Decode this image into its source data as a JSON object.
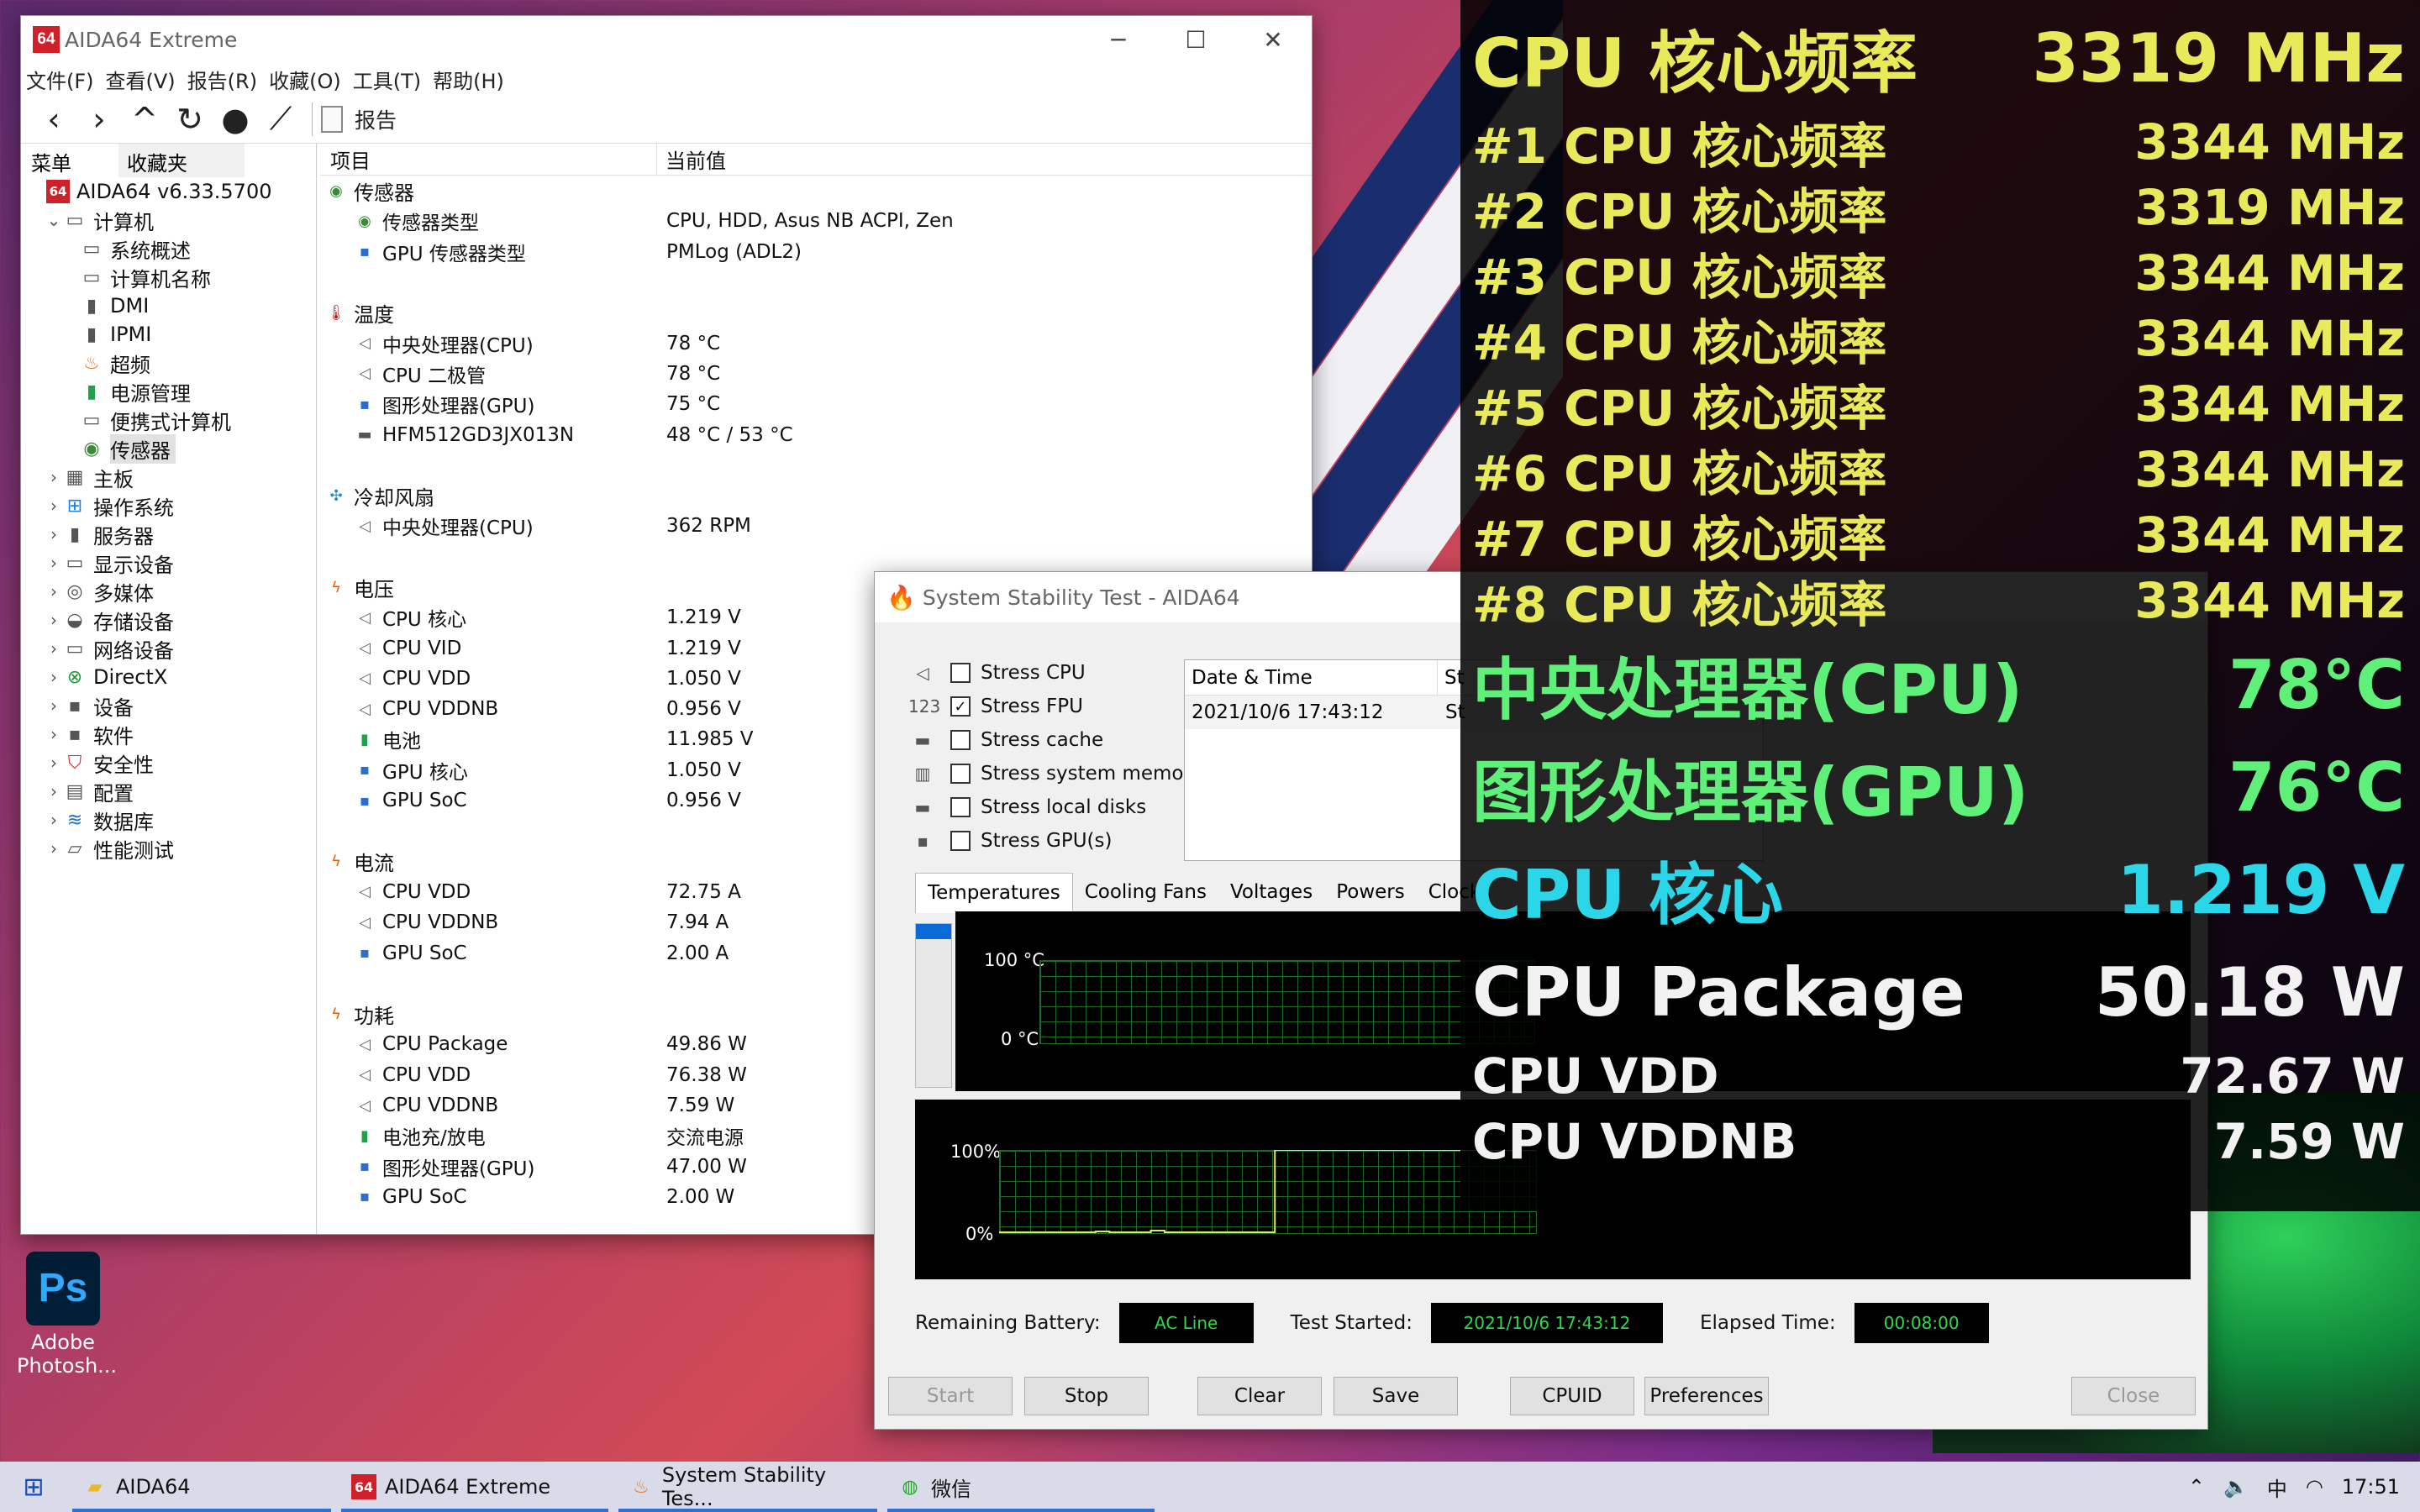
{
  "main_window": {
    "title": "AIDA64 Extreme",
    "menu": [
      "文件(F)",
      "查看(V)",
      "报告(R)",
      "收藏(O)",
      "工具(T)",
      "帮助(H)"
    ],
    "toolbar_report": "报告",
    "left_tabs": [
      "菜单",
      "收藏夹"
    ],
    "tree": [
      {
        "label": "AIDA64 v6.33.5700",
        "icon": "aida64-icon",
        "level": 0,
        "expander": ""
      },
      {
        "label": "计算机",
        "icon": "computer-icon",
        "level": 1,
        "expander": "v"
      },
      {
        "label": "系统概述",
        "icon": "computer-icon",
        "level": 2,
        "expander": ""
      },
      {
        "label": "计算机名称",
        "icon": "computer-icon",
        "level": 2,
        "expander": ""
      },
      {
        "label": "DMI",
        "icon": "dmi-icon",
        "level": 2,
        "expander": ""
      },
      {
        "label": "IPMI",
        "icon": "ipmi-icon",
        "level": 2,
        "expander": ""
      },
      {
        "label": "超频",
        "icon": "flame-icon",
        "level": 2,
        "expander": ""
      },
      {
        "label": "电源管理",
        "icon": "battery-icon",
        "level": 2,
        "expander": ""
      },
      {
        "label": "便携式计算机",
        "icon": "laptop-icon",
        "level": 2,
        "expander": ""
      },
      {
        "label": "传感器",
        "icon": "sensor-icon",
        "level": 2,
        "expander": "",
        "selected": true
      },
      {
        "label": "主板",
        "icon": "motherboard-icon",
        "level": 1,
        "expander": ">"
      },
      {
        "label": "操作系统",
        "icon": "windows-icon",
        "level": 1,
        "expander": ">"
      },
      {
        "label": "服务器",
        "icon": "server-icon",
        "level": 1,
        "expander": ">"
      },
      {
        "label": "显示设备",
        "icon": "monitor-icon",
        "level": 1,
        "expander": ">"
      },
      {
        "label": "多媒体",
        "icon": "multimedia-icon",
        "level": 1,
        "expander": ">"
      },
      {
        "label": "存储设备",
        "icon": "storage-icon",
        "level": 1,
        "expander": ">"
      },
      {
        "label": "网络设备",
        "icon": "network-icon",
        "level": 1,
        "expander": ">"
      },
      {
        "label": "DirectX",
        "icon": "xbox-icon",
        "level": 1,
        "expander": ">"
      },
      {
        "label": "设备",
        "icon": "device-icon",
        "level": 1,
        "expander": ">"
      },
      {
        "label": "软件",
        "icon": "software-icon",
        "level": 1,
        "expander": ">"
      },
      {
        "label": "安全性",
        "icon": "shield-icon",
        "level": 1,
        "expander": ">"
      },
      {
        "label": "配置",
        "icon": "config-icon",
        "level": 1,
        "expander": ">"
      },
      {
        "label": "数据库",
        "icon": "database-icon",
        "level": 1,
        "expander": ">"
      },
      {
        "label": "性能测试",
        "icon": "benchmark-icon",
        "level": 1,
        "expander": ">"
      }
    ],
    "columns": [
      "项目",
      "当前值"
    ],
    "groups": [
      {
        "name": "传感器",
        "icon": "sensor-icon",
        "items": [
          {
            "k": "传感器类型",
            "v": "CPU, HDD, Asus NB ACPI, Zen",
            "icon": "sensor-icon"
          },
          {
            "k": "GPU 传感器类型",
            "v": "PMLog  (ADL2)",
            "icon": "gpu-icon"
          }
        ]
      },
      {
        "name": "温度",
        "icon": "thermometer-icon",
        "items": [
          {
            "k": "中央处理器(CPU)",
            "v": "78 °C",
            "icon": "cpu-icon"
          },
          {
            "k": "CPU 二极管",
            "v": "78 °C",
            "icon": "cpu-icon"
          },
          {
            "k": "图形处理器(GPU)",
            "v": "75 °C",
            "icon": "gpu-icon"
          },
          {
            "k": "HFM512GD3JX013N",
            "v": "48 °C / 53 °C",
            "icon": "disk-icon"
          }
        ]
      },
      {
        "name": "冷却风扇",
        "icon": "fan-icon",
        "items": [
          {
            "k": "中央处理器(CPU)",
            "v": "362 RPM",
            "icon": "cpu-icon"
          }
        ]
      },
      {
        "name": "电压",
        "icon": "voltage-icon",
        "items": [
          {
            "k": "CPU 核心",
            "v": "1.219 V",
            "icon": "cpu-icon"
          },
          {
            "k": "CPU VID",
            "v": "1.219 V",
            "icon": "cpu-icon"
          },
          {
            "k": "CPU VDD",
            "v": "1.050 V",
            "icon": "cpu-icon"
          },
          {
            "k": "CPU VDDNB",
            "v": "0.956 V",
            "icon": "cpu-icon"
          },
          {
            "k": "电池",
            "v": "11.985 V",
            "icon": "battery-icon"
          },
          {
            "k": "GPU 核心",
            "v": "1.050 V",
            "icon": "gpu-icon"
          },
          {
            "k": "GPU SoC",
            "v": "0.956 V",
            "icon": "gpu-icon"
          }
        ]
      },
      {
        "name": "电流",
        "icon": "current-icon",
        "items": [
          {
            "k": "CPU VDD",
            "v": "72.75 A",
            "icon": "cpu-icon"
          },
          {
            "k": "CPU VDDNB",
            "v": "7.94 A",
            "icon": "cpu-icon"
          },
          {
            "k": "GPU SoC",
            "v": "2.00 A",
            "icon": "gpu-icon"
          }
        ]
      },
      {
        "name": "功耗",
        "icon": "power-icon",
        "items": [
          {
            "k": "CPU Package",
            "v": "49.86 W",
            "icon": "cpu-icon"
          },
          {
            "k": "CPU VDD",
            "v": "76.38 W",
            "icon": "cpu-icon"
          },
          {
            "k": "CPU VDDNB",
            "v": "7.59 W",
            "icon": "cpu-icon"
          },
          {
            "k": "电池充/放电",
            "v": "交流电源",
            "icon": "battery-icon"
          },
          {
            "k": "图形处理器(GPU)",
            "v": "47.00 W",
            "icon": "gpu-icon"
          },
          {
            "k": "GPU SoC",
            "v": "2.00 W",
            "icon": "gpu-icon"
          }
        ]
      }
    ]
  },
  "stability": {
    "title": "System Stability Test - AIDA64",
    "stress": [
      {
        "label": "Stress CPU",
        "checked": false,
        "icon": "cpu-chip-icon"
      },
      {
        "label": "Stress FPU",
        "checked": true,
        "icon": "fpu-icon"
      },
      {
        "label": "Stress cache",
        "checked": false,
        "icon": "cache-icon"
      },
      {
        "label": "Stress system memory",
        "checked": false,
        "icon": "memory-icon"
      },
      {
        "label": "Stress local disks",
        "checked": false,
        "icon": "disk-icon"
      },
      {
        "label": "Stress GPU(s)",
        "checked": false,
        "icon": "gpu-icon"
      }
    ],
    "log_headers": [
      "Date & Time",
      "St"
    ],
    "log_rows": [
      {
        "time": "2021/10/6 17:43:12",
        "status": "St"
      }
    ],
    "tabs": [
      "Temperatures",
      "Cooling Fans",
      "Voltages",
      "Powers",
      "Clocks"
    ],
    "graph1_labels": [
      "100 °C",
      "0 °C"
    ],
    "graph2_labels": [
      "100%",
      "0%"
    ],
    "graph2_series": {
      "cpu_usage_percent": [
        2,
        2,
        2,
        2,
        2,
        2,
        2,
        3,
        2,
        2,
        2,
        4,
        2,
        2,
        2,
        2,
        2,
        2,
        2,
        2,
        100,
        100,
        100,
        100,
        100,
        100,
        100,
        100,
        100,
        100,
        100,
        100,
        100,
        100,
        100,
        100,
        100,
        100,
        100,
        100
      ]
    },
    "status": {
      "battery_label": "Remaining Battery:",
      "battery": "AC Line",
      "started_label": "Test Started:",
      "started": "2021/10/6 17:43:12",
      "elapsed_label": "Elapsed Time:",
      "elapsed": "00:08:00"
    },
    "buttons": {
      "start": "Start",
      "stop": "Stop",
      "clear": "Clear",
      "save": "Save",
      "cpuid": "CPUID",
      "preferences": "Preferences",
      "close": "Close"
    }
  },
  "osd": [
    {
      "label": "CPU 核心频率",
      "value": "3319 MHz",
      "color": "#e8ea5a",
      "size": "big"
    },
    {
      "label": "#1 CPU 核心频率",
      "value": "3344 MHz",
      "color": "#e8ea5a",
      "size": "med"
    },
    {
      "label": "#2 CPU 核心频率",
      "value": "3319 MHz",
      "color": "#e8ea5a",
      "size": "med"
    },
    {
      "label": "#3 CPU 核心频率",
      "value": "3344 MHz",
      "color": "#e8ea5a",
      "size": "med"
    },
    {
      "label": "#4 CPU 核心频率",
      "value": "3344 MHz",
      "color": "#e8ea5a",
      "size": "med"
    },
    {
      "label": "#5 CPU 核心频率",
      "value": "3344 MHz",
      "color": "#e8ea5a",
      "size": "med"
    },
    {
      "label": "#6 CPU 核心频率",
      "value": "3344 MHz",
      "color": "#e8ea5a",
      "size": "med"
    },
    {
      "label": "#7 CPU 核心频率",
      "value": "3344 MHz",
      "color": "#e8ea5a",
      "size": "med"
    },
    {
      "label": "#8 CPU 核心频率",
      "value": "3344 MHz",
      "color": "#e8ea5a",
      "size": "med"
    },
    {
      "label": "中央处理器(CPU)",
      "value": "78°C",
      "color": "#5ff07a",
      "size": "big"
    },
    {
      "label": "图形处理器(GPU)",
      "value": "76°C",
      "color": "#5ff07a",
      "size": "big"
    },
    {
      "label": "CPU 核心",
      "value": "1.219 V",
      "color": "#2ad6e8",
      "size": "big"
    },
    {
      "label": "CPU Package",
      "value": "50.18 W",
      "color": "#f2f2f2",
      "size": "big"
    },
    {
      "label": "CPU VDD",
      "value": "72.67 W",
      "color": "#f2f2f2",
      "size": "med"
    },
    {
      "label": "CPU VDDNB",
      "value": "7.59 W",
      "color": "#f2f2f2",
      "size": "med"
    }
  ],
  "desktop": {
    "icon_label_1": "Adobe",
    "icon_label_2": "Photosh...",
    "icon_text": "Ps"
  },
  "taskbar": {
    "items": [
      {
        "label": "AIDA64",
        "icon": "folder-icon"
      },
      {
        "label": "AIDA64 Extreme",
        "icon": "aida64-icon"
      },
      {
        "label": "System Stability Tes...",
        "icon": "flame-icon"
      },
      {
        "label": "微信",
        "icon": "wechat-icon"
      }
    ],
    "ime": "中",
    "time": "17:51"
  }
}
